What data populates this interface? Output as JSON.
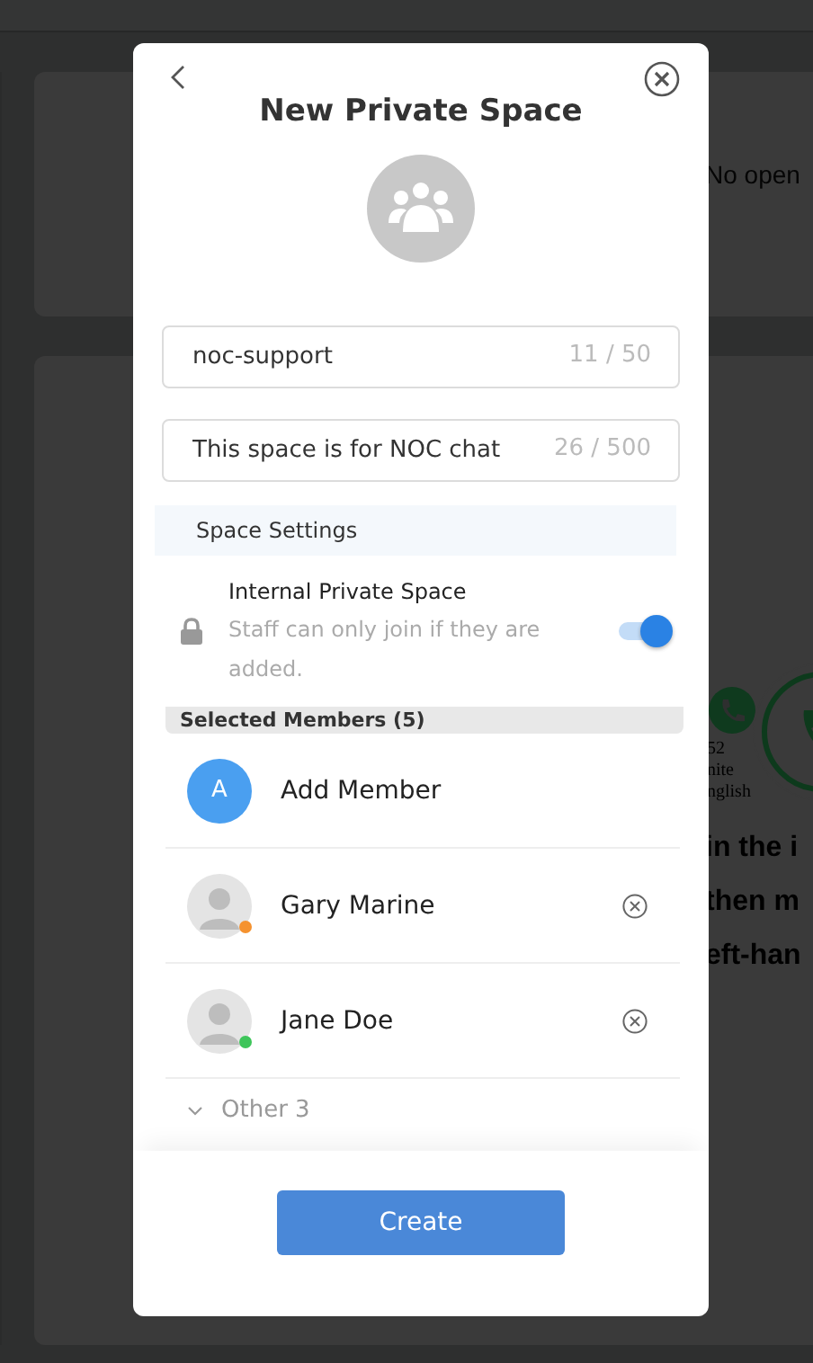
{
  "background": {
    "card_text": "No open",
    "contact_lines": [
      "52",
      "nite",
      "nglish"
    ],
    "instructions": [
      "in the i",
      "then m",
      "eft-han"
    ]
  },
  "dialog": {
    "title": "New Private Space",
    "fields": [
      {
        "value": "noc-support",
        "counter": "11 / 50"
      },
      {
        "value": "This space is for NOC chat",
        "counter": "26 / 500"
      }
    ],
    "settings": {
      "heading": "Space Settings",
      "option": {
        "title": "Internal Private Space",
        "description": "Staff can only join if they are added.",
        "on": true
      }
    },
    "members": {
      "heading": "Selected Members (5)",
      "add": {
        "initial": "A",
        "label": "Add Member"
      },
      "list": [
        {
          "name": "Gary Marine",
          "color": "#f5922f"
        },
        {
          "name": "Jane Doe",
          "color": "#3ec55a"
        }
      ],
      "more": {
        "label": "Other 3",
        "expanded": false
      }
    },
    "submit": "Create"
  }
}
